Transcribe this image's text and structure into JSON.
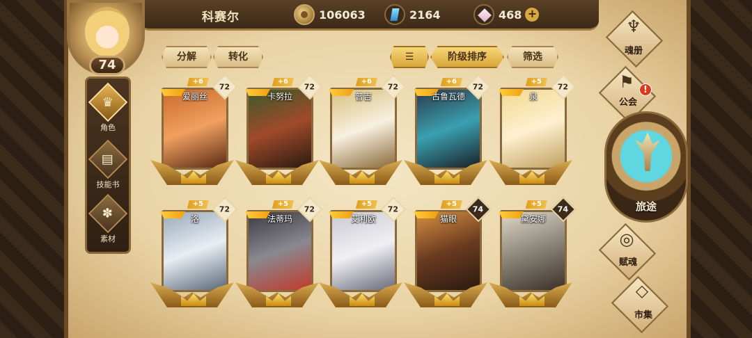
{
  "player": {
    "name": "科赛尔",
    "level": "74"
  },
  "resources": {
    "gold": "106063",
    "crystal": "2164",
    "gem": "468",
    "gem_add": "+"
  },
  "sidenav": {
    "items": [
      {
        "label": "角色",
        "icon": "helmet-icon"
      },
      {
        "label": "技能书",
        "icon": "skillbook-icon"
      },
      {
        "label": "素材",
        "icon": "material-icon"
      }
    ]
  },
  "toolbar": {
    "decompose": "分解",
    "convert": "转化",
    "sort_icon": "sort-icon",
    "rank_sort": "阶级排序",
    "filter": "筛选"
  },
  "heroes": [
    {
      "name": "爱丽丝",
      "plus": "+6",
      "level": "72"
    },
    {
      "name": "卡努拉",
      "plus": "+6",
      "level": "72"
    },
    {
      "name": "普吉",
      "plus": "+6",
      "level": "72"
    },
    {
      "name": "古鲁瓦德",
      "plus": "+6",
      "level": "72"
    },
    {
      "name": "泉",
      "plus": "+5",
      "level": "72"
    },
    {
      "name": "洛",
      "plus": "+5",
      "level": "72"
    },
    {
      "name": "法蒂玛",
      "plus": "+5",
      "level": "72"
    },
    {
      "name": "艾利欧",
      "plus": "+5",
      "level": "72"
    },
    {
      "name": "猫眼",
      "plus": "+5",
      "level": "74"
    },
    {
      "name": "黛安娜",
      "plus": "+5",
      "level": "74"
    }
  ],
  "rightmenu": {
    "soulbook": "魂册",
    "guild": "公会",
    "guild_alert": "!",
    "journey": "旅途",
    "talent": "赋魂",
    "market": "市集"
  },
  "colors": {
    "gold_accent": "#d8a63a",
    "parchment": "#e9d3a4",
    "journey_teal": "#5fd6e0"
  }
}
